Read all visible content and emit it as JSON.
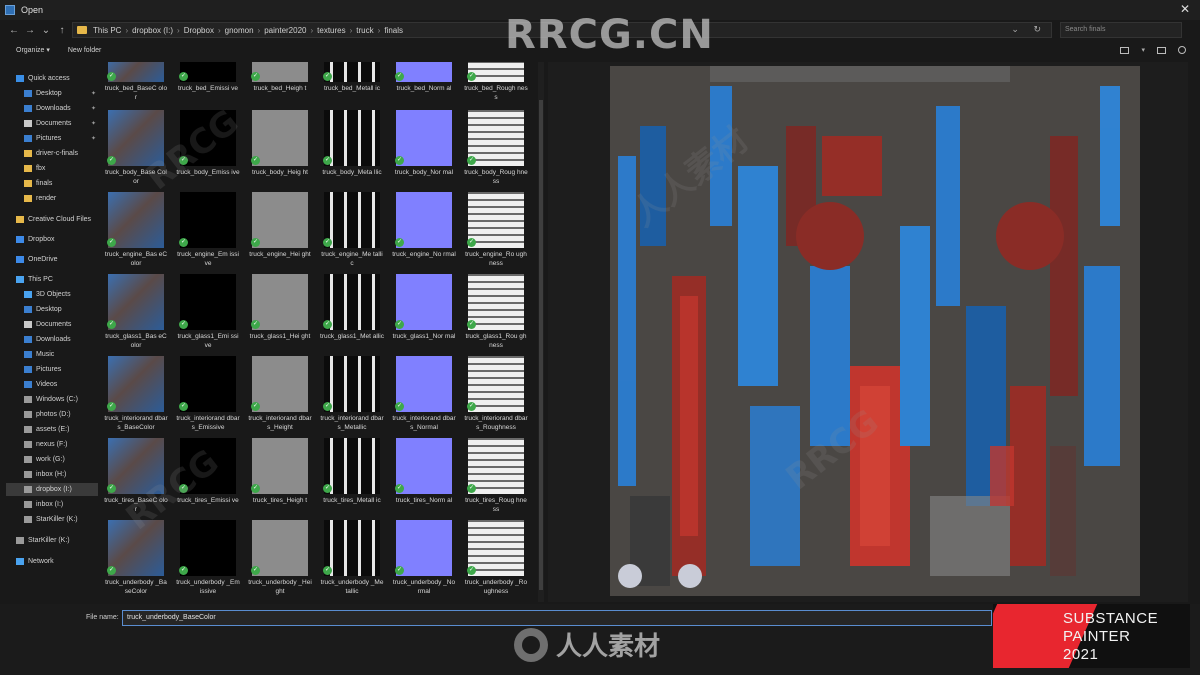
{
  "window": {
    "title": "Open",
    "close_glyph": "✕"
  },
  "nav_buttons": [
    "←",
    "→",
    "⌄",
    "↑"
  ],
  "breadcrumb": [
    "This PC",
    "dropbox (I:)",
    "Dropbox",
    "gnomon",
    "painter2020",
    "textures",
    "truck",
    "finals"
  ],
  "breadcrumb_sep": "›",
  "address_controls": "⌄ ↻",
  "search": {
    "placeholder": "Search finals"
  },
  "toolbar": {
    "organize": "Organize ▾",
    "new_folder": "New folder",
    "view_caret": "▾"
  },
  "sidebar": [
    {
      "label": "Quick access",
      "icon": "star-icon",
      "color": "#3a8ee6"
    },
    {
      "label": "Desktop",
      "icon": "desktop-icon",
      "color": "#3b7fd0",
      "pinned": true
    },
    {
      "label": "Downloads",
      "icon": "downloads-icon",
      "color": "#3b7fd0",
      "pinned": true
    },
    {
      "label": "Documents",
      "icon": "documents-icon",
      "color": "#c9c9c9",
      "pinned": true
    },
    {
      "label": "Pictures",
      "icon": "pictures-icon",
      "color": "#3b7fd0",
      "pinned": true
    },
    {
      "label": "driver-c-finals",
      "icon": "folder-icon",
      "color": "#e6b84a"
    },
    {
      "label": "fbx",
      "icon": "folder-icon",
      "color": "#e6b84a"
    },
    {
      "label": "finals",
      "icon": "folder-icon",
      "color": "#e6b84a"
    },
    {
      "label": "render",
      "icon": "folder-icon",
      "color": "#e6b84a"
    },
    {
      "label": "Creative Cloud Files",
      "icon": "creative-cloud-icon",
      "color": "#e6b84a"
    },
    {
      "label": "Dropbox",
      "icon": "dropbox-icon",
      "color": "#3d8ae8"
    },
    {
      "label": "OneDrive",
      "icon": "onedrive-icon",
      "color": "#3d8ae8"
    },
    {
      "label": "This PC",
      "icon": "pc-icon",
      "color": "#4aa3f0"
    },
    {
      "label": "3D Objects",
      "icon": "objects-3d-icon",
      "color": "#4aa3f0"
    },
    {
      "label": "Desktop",
      "icon": "desktop-icon",
      "color": "#3b7fd0"
    },
    {
      "label": "Documents",
      "icon": "documents-icon",
      "color": "#c9c9c9"
    },
    {
      "label": "Downloads",
      "icon": "downloads-icon",
      "color": "#3b7fd0"
    },
    {
      "label": "Music",
      "icon": "music-icon",
      "color": "#3b7fd0"
    },
    {
      "label": "Pictures",
      "icon": "pictures-icon",
      "color": "#3b7fd0"
    },
    {
      "label": "Videos",
      "icon": "videos-icon",
      "color": "#3b7fd0"
    },
    {
      "label": "Windows (C:)",
      "icon": "drive-icon",
      "color": "#9a9a9a"
    },
    {
      "label": "photos (D:)",
      "icon": "drive-icon",
      "color": "#9a9a9a"
    },
    {
      "label": "assets (E:)",
      "icon": "drive-icon",
      "color": "#9a9a9a"
    },
    {
      "label": "nexus (F:)",
      "icon": "drive-icon",
      "color": "#9a9a9a"
    },
    {
      "label": "work (G:)",
      "icon": "drive-icon",
      "color": "#9a9a9a"
    },
    {
      "label": "inbox (H:)",
      "icon": "drive-icon",
      "color": "#9a9a9a"
    },
    {
      "label": "dropbox (I:)",
      "icon": "drive-icon",
      "color": "#9a9a9a",
      "selected": true
    },
    {
      "label": "inbox (I:)",
      "icon": "drive-icon",
      "color": "#9a9a9a"
    },
    {
      "label": "StarKiller (K:)",
      "icon": "drive-icon",
      "color": "#9a9a9a"
    },
    {
      "label": "StarKiller (K:)",
      "icon": "drive-icon",
      "color": "#9a9a9a"
    },
    {
      "label": "Network",
      "icon": "network-icon",
      "color": "#4aa3f0"
    }
  ],
  "files": [
    [
      "truck_bed_BaseC olor",
      "truck_bed_Emissi ve",
      "truck_bed_Heigh t",
      "truck_bed_Metall ic",
      "truck_bed_Norm al",
      "truck_bed_Rough ness"
    ],
    [
      "truck_body_Base Color",
      "truck_body_Emiss ive",
      "truck_body_Heig ht",
      "truck_body_Meta llic",
      "truck_body_Nor mal",
      "truck_body_Roug hness"
    ],
    [
      "truck_engine_Bas eColor",
      "truck_engine_Em issive",
      "truck_engine_Hei ght",
      "truck_engine_Me tallic",
      "truck_engine_No rmal",
      "truck_engine_Ro ughness"
    ],
    [
      "truck_glass1_Bas eColor",
      "truck_glass1_Emi ssive",
      "truck_glass1_Hei ght",
      "truck_glass1_Met allic",
      "truck_glass1_Nor mal",
      "truck_glass1_Rou ghness"
    ],
    [
      "truck_interiorand dbars_BaseColor",
      "truck_interiorand dbars_Emissive",
      "truck_interiorand dbars_Height",
      "truck_interiorand dbars_Metallic",
      "truck_interiorand dbars_Normal",
      "truck_interiorand dbars_Roughness"
    ],
    [
      "truck_tires_BaseC olor",
      "truck_tires_Emissi ve",
      "truck_tires_Heigh t",
      "truck_tires_Metall ic",
      "truck_tires_Norm al",
      "truck_tires_Roug hness"
    ],
    [
      "truck_underbody _BaseColor",
      "truck_underbody _Emissive",
      "truck_underbody _Height",
      "truck_underbody _Metallic",
      "truck_underbody _Normal",
      "truck_underbody _Roughness"
    ]
  ],
  "map_colors": {
    "BaseColor": "#4a5f82",
    "Emissive": "#000000",
    "Height": "#8c8c8c",
    "Metallic": "#0a0a0a",
    "Normal": "#8080ff",
    "Roughness": "#cfcfcf",
    "check": "#3ea84a"
  },
  "footer": {
    "file_name_label": "File name:",
    "file_name_value": "truck_underbody_BaseColor"
  },
  "watermarks": {
    "top": "RRCG.CN",
    "bottom": "人人素材",
    "diagonal": "RRCG"
  },
  "badge": {
    "line1": "SUBSTANCE",
    "line2": "PAINTER",
    "line3": "2021"
  }
}
